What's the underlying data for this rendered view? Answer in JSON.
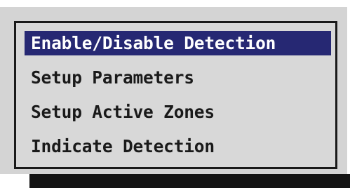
{
  "menu": {
    "items": [
      {
        "label": "Enable/Disable Detection",
        "selected": true
      },
      {
        "label": "Setup Parameters",
        "selected": false
      },
      {
        "label": "Setup Active Zones",
        "selected": false
      },
      {
        "label": "Indicate Detection",
        "selected": false
      }
    ]
  },
  "colors": {
    "selection_background": "#262873",
    "selection_text": "#ffffff",
    "text": "#1a1a1a",
    "panel_background": "#d4d4d4",
    "frame_border": "#1a1a1a",
    "shadow": "#141414"
  }
}
